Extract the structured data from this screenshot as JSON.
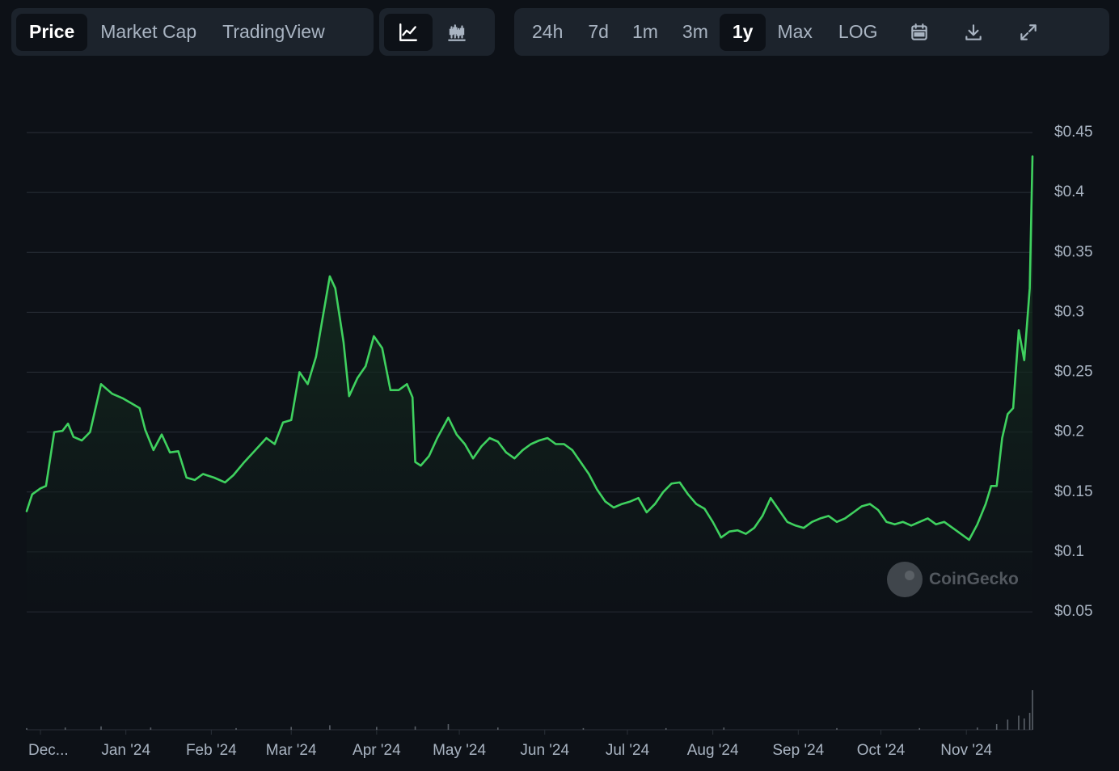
{
  "toolbar": {
    "view_tabs": [
      {
        "label": "Price",
        "active": true
      },
      {
        "label": "Market Cap",
        "active": false
      },
      {
        "label": "TradingView",
        "active": false
      }
    ],
    "chart_type_icons": [
      "line-chart-icon",
      "candlestick-chart-icon"
    ],
    "ranges": [
      {
        "label": "24h",
        "active": false
      },
      {
        "label": "7d",
        "active": false
      },
      {
        "label": "1m",
        "active": false
      },
      {
        "label": "3m",
        "active": false
      },
      {
        "label": "1y",
        "active": true
      },
      {
        "label": "Max",
        "active": false
      },
      {
        "label": "LOG",
        "active": false
      }
    ],
    "action_icons": [
      "calendar-icon",
      "download-icon",
      "fullscreen-icon"
    ]
  },
  "watermark": {
    "text": "CoinGecko"
  },
  "colors": {
    "line": "#3fd15f",
    "area_top": "#163c22",
    "grid": "#2a3038",
    "volume": "#5a6068"
  },
  "chart_data": {
    "type": "area",
    "ylim": [
      0.05,
      0.45
    ],
    "y_ticks": [
      0.05,
      0.1,
      0.15,
      0.2,
      0.25,
      0.3,
      0.35,
      0.4,
      0.45
    ],
    "y_tick_labels": [
      "$0.05",
      "$0.1",
      "$0.15",
      "$0.2",
      "$0.25",
      "$0.3",
      "$0.35",
      "$0.4",
      "$0.45"
    ],
    "x_tick_labels": [
      "Dec...",
      "Jan '24",
      "Feb '24",
      "Mar '24",
      "Apr '24",
      "May '24",
      "Jun '24",
      "Jul '24",
      "Aug '24",
      "Sep '24",
      "Oct '24",
      "Nov '24"
    ],
    "x_tick_dates": [
      "2023-12-01",
      "2024-01-01",
      "2024-02-01",
      "2024-03-01",
      "2024-04-01",
      "2024-05-01",
      "2024-06-01",
      "2024-07-01",
      "2024-08-01",
      "2024-09-01",
      "2024-10-01",
      "2024-11-01"
    ],
    "x_range": [
      "2023-11-26",
      "2024-11-25"
    ],
    "series": [
      {
        "points": [
          [
            "2023-11-26",
            0.134
          ],
          [
            "2023-11-28",
            0.148
          ],
          [
            "2023-12-01",
            0.153
          ],
          [
            "2023-12-03",
            0.155
          ],
          [
            "2023-12-06",
            0.2
          ],
          [
            "2023-12-09",
            0.201
          ],
          [
            "2023-12-11",
            0.207
          ],
          [
            "2023-12-13",
            0.196
          ],
          [
            "2023-12-16",
            0.193
          ],
          [
            "2023-12-19",
            0.2
          ],
          [
            "2023-12-23",
            0.24
          ],
          [
            "2023-12-27",
            0.232
          ],
          [
            "2023-12-31",
            0.228
          ],
          [
            "2024-01-03",
            0.224
          ],
          [
            "2024-01-06",
            0.22
          ],
          [
            "2024-01-08",
            0.202
          ],
          [
            "2024-01-11",
            0.185
          ],
          [
            "2024-01-14",
            0.198
          ],
          [
            "2024-01-17",
            0.183
          ],
          [
            "2024-01-20",
            0.184
          ],
          [
            "2024-01-23",
            0.162
          ],
          [
            "2024-01-26",
            0.16
          ],
          [
            "2024-01-29",
            0.165
          ],
          [
            "2024-02-02",
            0.162
          ],
          [
            "2024-02-06",
            0.158
          ],
          [
            "2024-02-09",
            0.164
          ],
          [
            "2024-02-13",
            0.175
          ],
          [
            "2024-02-17",
            0.185
          ],
          [
            "2024-02-21",
            0.195
          ],
          [
            "2024-02-24",
            0.19
          ],
          [
            "2024-02-27",
            0.208
          ],
          [
            "2024-03-01",
            0.21
          ],
          [
            "2024-03-04",
            0.25
          ],
          [
            "2024-03-07",
            0.24
          ],
          [
            "2024-03-10",
            0.263
          ],
          [
            "2024-03-12",
            0.29
          ],
          [
            "2024-03-15",
            0.33
          ],
          [
            "2024-03-17",
            0.32
          ],
          [
            "2024-03-20",
            0.275
          ],
          [
            "2024-03-22",
            0.23
          ],
          [
            "2024-03-25",
            0.245
          ],
          [
            "2024-03-28",
            0.255
          ],
          [
            "2024-03-31",
            0.28
          ],
          [
            "2024-04-03",
            0.27
          ],
          [
            "2024-04-06",
            0.235
          ],
          [
            "2024-04-09",
            0.235
          ],
          [
            "2024-04-12",
            0.24
          ],
          [
            "2024-04-14",
            0.229
          ],
          [
            "2024-04-15",
            0.175
          ],
          [
            "2024-04-17",
            0.172
          ],
          [
            "2024-04-20",
            0.18
          ],
          [
            "2024-04-23",
            0.195
          ],
          [
            "2024-04-27",
            0.212
          ],
          [
            "2024-04-30",
            0.198
          ],
          [
            "2024-05-03",
            0.19
          ],
          [
            "2024-05-06",
            0.178
          ],
          [
            "2024-05-09",
            0.188
          ],
          [
            "2024-05-12",
            0.195
          ],
          [
            "2024-05-15",
            0.192
          ],
          [
            "2024-05-18",
            0.183
          ],
          [
            "2024-05-21",
            0.178
          ],
          [
            "2024-05-24",
            0.185
          ],
          [
            "2024-05-27",
            0.19
          ],
          [
            "2024-05-30",
            0.193
          ],
          [
            "2024-06-02",
            0.195
          ],
          [
            "2024-06-05",
            0.19
          ],
          [
            "2024-06-08",
            0.19
          ],
          [
            "2024-06-11",
            0.185
          ],
          [
            "2024-06-14",
            0.175
          ],
          [
            "2024-06-17",
            0.165
          ],
          [
            "2024-06-20",
            0.152
          ],
          [
            "2024-06-23",
            0.142
          ],
          [
            "2024-06-26",
            0.137
          ],
          [
            "2024-06-29",
            0.14
          ],
          [
            "2024-07-02",
            0.142
          ],
          [
            "2024-07-05",
            0.145
          ],
          [
            "2024-07-08",
            0.133
          ],
          [
            "2024-07-11",
            0.14
          ],
          [
            "2024-07-14",
            0.15
          ],
          [
            "2024-07-17",
            0.157
          ],
          [
            "2024-07-20",
            0.158
          ],
          [
            "2024-07-23",
            0.148
          ],
          [
            "2024-07-26",
            0.14
          ],
          [
            "2024-07-29",
            0.136
          ],
          [
            "2024-08-01",
            0.125
          ],
          [
            "2024-08-04",
            0.112
          ],
          [
            "2024-08-07",
            0.117
          ],
          [
            "2024-08-10",
            0.118
          ],
          [
            "2024-08-13",
            0.115
          ],
          [
            "2024-08-16",
            0.12
          ],
          [
            "2024-08-19",
            0.13
          ],
          [
            "2024-08-22",
            0.145
          ],
          [
            "2024-08-25",
            0.135
          ],
          [
            "2024-08-28",
            0.125
          ],
          [
            "2024-08-31",
            0.122
          ],
          [
            "2024-09-03",
            0.12
          ],
          [
            "2024-09-06",
            0.125
          ],
          [
            "2024-09-09",
            0.128
          ],
          [
            "2024-09-12",
            0.13
          ],
          [
            "2024-09-15",
            0.125
          ],
          [
            "2024-09-18",
            0.128
          ],
          [
            "2024-09-21",
            0.133
          ],
          [
            "2024-09-24",
            0.138
          ],
          [
            "2024-09-27",
            0.14
          ],
          [
            "2024-09-30",
            0.135
          ],
          [
            "2024-10-03",
            0.125
          ],
          [
            "2024-10-06",
            0.123
          ],
          [
            "2024-10-09",
            0.125
          ],
          [
            "2024-10-12",
            0.122
          ],
          [
            "2024-10-15",
            0.125
          ],
          [
            "2024-10-18",
            0.128
          ],
          [
            "2024-10-21",
            0.123
          ],
          [
            "2024-10-24",
            0.125
          ],
          [
            "2024-10-27",
            0.12
          ],
          [
            "2024-10-30",
            0.115
          ],
          [
            "2024-11-02",
            0.11
          ],
          [
            "2024-11-05",
            0.123
          ],
          [
            "2024-11-08",
            0.14
          ],
          [
            "2024-11-10",
            0.155
          ],
          [
            "2024-11-12",
            0.155
          ],
          [
            "2024-11-14",
            0.195
          ],
          [
            "2024-11-16",
            0.215
          ],
          [
            "2024-11-18",
            0.22
          ],
          [
            "2024-11-20",
            0.285
          ],
          [
            "2024-11-22",
            0.26
          ],
          [
            "2024-11-23",
            0.29
          ],
          [
            "2024-11-24",
            0.32
          ],
          [
            "2024-11-25",
            0.43
          ]
        ]
      }
    ],
    "volume_points": [
      [
        "2023-11-26",
        0.03
      ],
      [
        "2023-12-10",
        0.04
      ],
      [
        "2023-12-23",
        0.06
      ],
      [
        "2024-01-10",
        0.04
      ],
      [
        "2024-02-10",
        0.03
      ],
      [
        "2024-03-01",
        0.05
      ],
      [
        "2024-03-15",
        0.08
      ],
      [
        "2024-04-01",
        0.05
      ],
      [
        "2024-04-15",
        0.06
      ],
      [
        "2024-04-27",
        0.1
      ],
      [
        "2024-05-15",
        0.04
      ],
      [
        "2024-06-15",
        0.03
      ],
      [
        "2024-07-15",
        0.03
      ],
      [
        "2024-08-05",
        0.04
      ],
      [
        "2024-09-15",
        0.03
      ],
      [
        "2024-10-15",
        0.03
      ],
      [
        "2024-11-05",
        0.04
      ],
      [
        "2024-11-12",
        0.1
      ],
      [
        "2024-11-16",
        0.18
      ],
      [
        "2024-11-20",
        0.25
      ],
      [
        "2024-11-22",
        0.2
      ],
      [
        "2024-11-24",
        0.3
      ],
      [
        "2024-11-25",
        0.7
      ]
    ]
  }
}
